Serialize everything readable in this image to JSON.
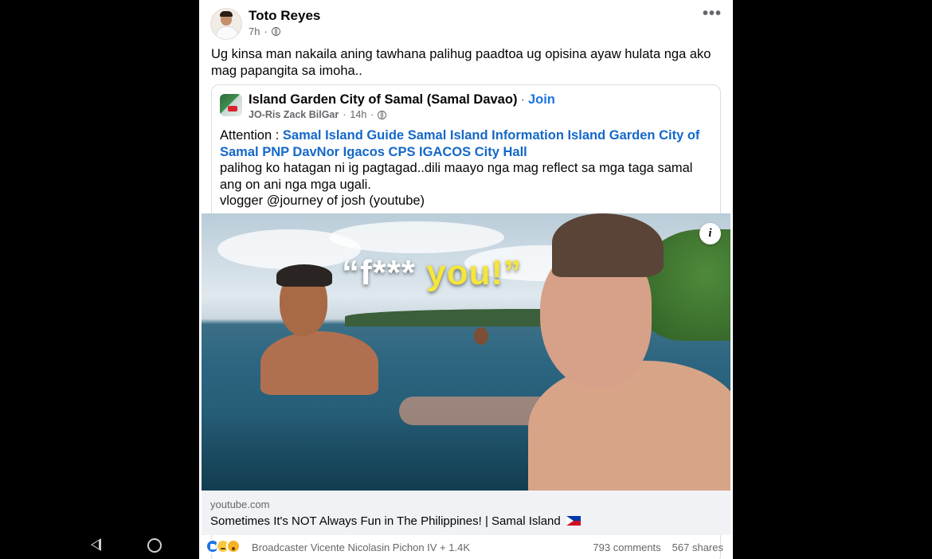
{
  "post": {
    "author": "Toto Reyes",
    "time": "7h",
    "separator": "·",
    "more_label": "•••",
    "text": "Ug kinsa man nakaila aning tawhana palihug paadtoa ug opisina ayaw hulata nga ako mag papangita sa imoha.."
  },
  "shared": {
    "group_name": "Island Garden City of Samal (Samal Davao)",
    "dot": "·",
    "join_label": "Join",
    "author": "JO-Ris Zack BilGar",
    "time": "14h",
    "separator": "·",
    "attention": "Attention : ",
    "tags": "Samal Island Guide Samal Island Information Island Garden City of Samal PNP DavNor Igacos CPS IGACOS City Hall",
    "line2": "palihog ko hatagan ni ig pagtagad..dili maayo nga mag reflect sa mga taga samal ang on ani nga mga ugali.",
    "line3": "vlogger  @journey of josh  (youtube)"
  },
  "media": {
    "caption_quote_open": "“f*** ",
    "caption_highlight": "you!”",
    "info_label": "i"
  },
  "link": {
    "domain": "youtube.com",
    "title": "Sometimes It's NOT Always Fun in The Philippines! | Samal Island"
  },
  "footer": {
    "reactions_text": "Broadcaster Vicente Nicolasin Pichon IV + 1.4K",
    "comments": "793 comments",
    "shares": "567 shares",
    "reaction_icons": [
      "like-icon",
      "sad-icon",
      "wow-icon"
    ]
  },
  "colors": {
    "link_blue": "#1468c9",
    "join_blue": "#1b74e4",
    "caption_yellow": "#f4e63a"
  }
}
